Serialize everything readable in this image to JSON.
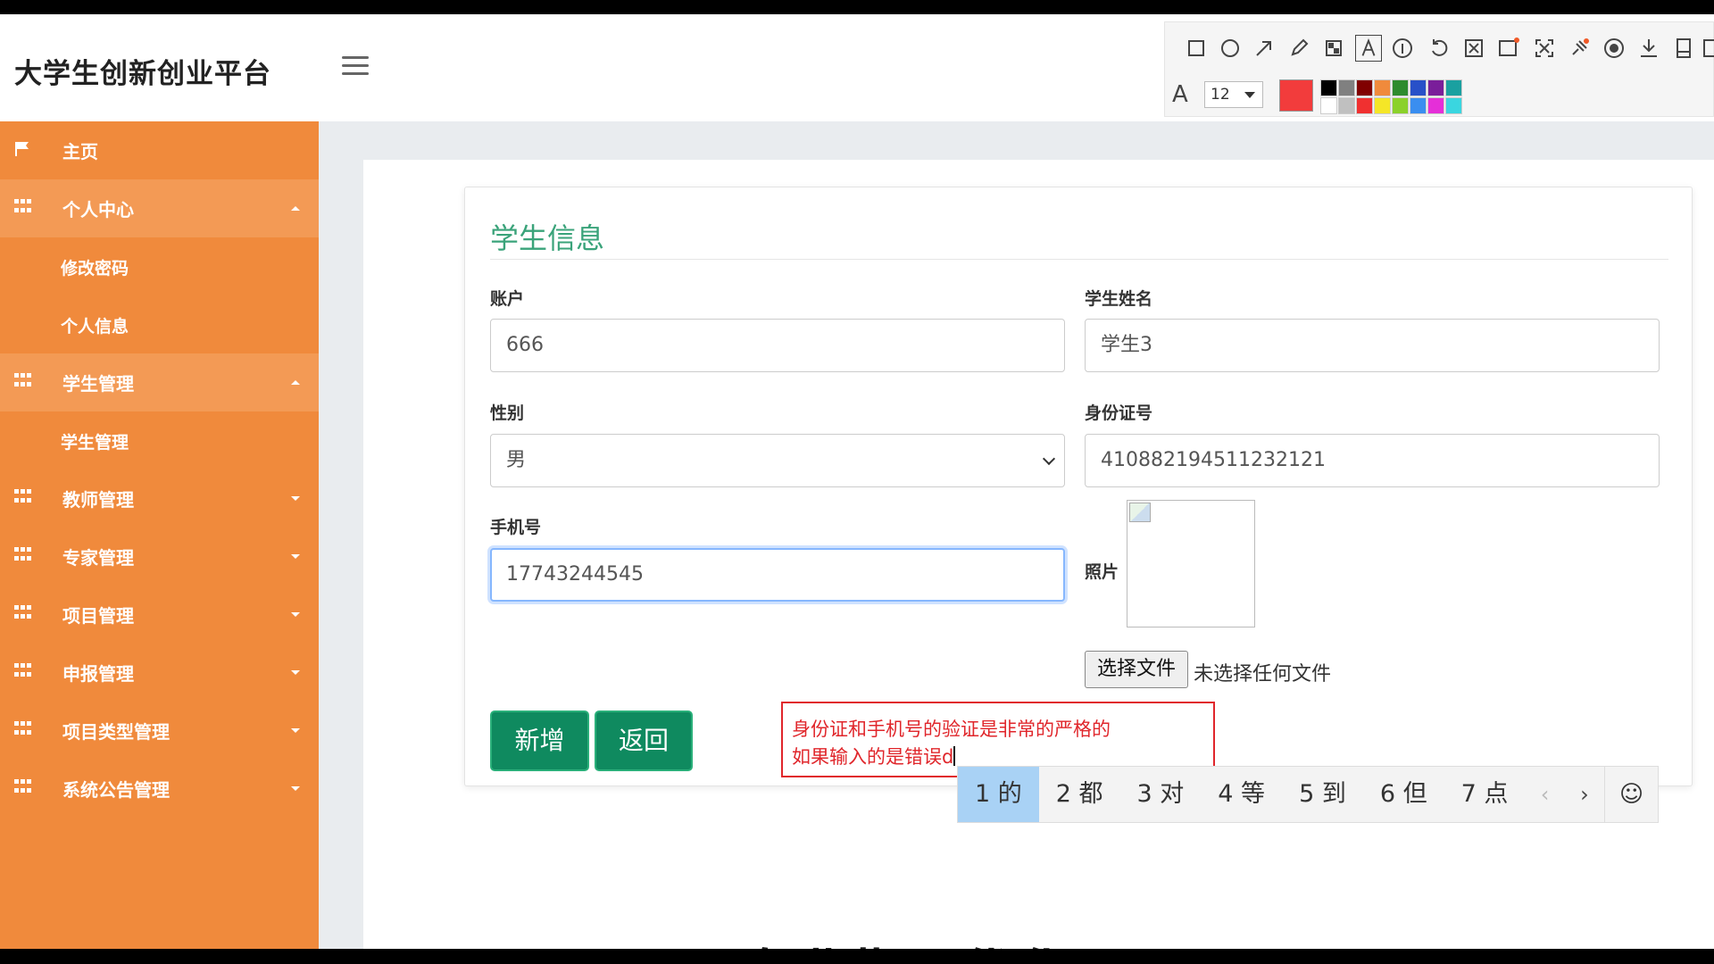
{
  "header": {
    "brand": "大学生创新创业平台"
  },
  "sidebar": {
    "items": [
      {
        "label": "主页",
        "icon": "flag-icon",
        "caret": ""
      },
      {
        "label": "个人中心",
        "icon": "grid-icon",
        "caret": "up",
        "children": [
          "修改密码",
          "个人信息"
        ]
      },
      {
        "label": "学生管理",
        "icon": "grid-icon",
        "caret": "up",
        "children": [
          "学生管理"
        ]
      },
      {
        "label": "教师管理",
        "icon": "grid-icon",
        "caret": "down"
      },
      {
        "label": "专家管理",
        "icon": "grid-icon",
        "caret": "down"
      },
      {
        "label": "项目管理",
        "icon": "grid-icon",
        "caret": "down"
      },
      {
        "label": "申报管理",
        "icon": "grid-icon",
        "caret": "down"
      },
      {
        "label": "项目类型管理",
        "icon": "grid-icon",
        "caret": "down"
      },
      {
        "label": "系统公告管理",
        "icon": "grid-icon",
        "caret": "down"
      }
    ]
  },
  "form": {
    "title": "学生信息",
    "account_label": "账户",
    "account_value": "666",
    "name_label": "学生姓名",
    "name_value": "学生3",
    "gender_label": "性别",
    "gender_value": "男",
    "idcard_label": "身份证号",
    "idcard_value": "410882194511232121",
    "phone_label": "手机号",
    "phone_value": "17743244545",
    "photo_label": "照片",
    "file_button": "选择文件",
    "file_status": "未选择任何文件",
    "submit_button": "新增",
    "back_button": "返回"
  },
  "annotation": {
    "line1": "身份证和手机号的验证是非常的严格的",
    "line2": "如果输入的是错误d",
    "color": "#e0262b"
  },
  "ime": {
    "candidates": [
      "1 的",
      "2 都",
      "3 对",
      "4 等",
      "5 到",
      "6 但",
      "7 点"
    ],
    "selected_index": 0,
    "prev": "‹",
    "next": "›",
    "emoji": "☺"
  },
  "screenshot_toolbar": {
    "tools": [
      "rectangle-icon",
      "ellipse-icon",
      "arrow-icon",
      "pen-icon",
      "mosaic-icon",
      "text-icon",
      "number-icon",
      "undo-icon",
      "cut-icon",
      "translate-icon",
      "fullscreen-icon",
      "pin-icon",
      "record-icon",
      "download-icon",
      "save-icon",
      "copy-icon"
    ],
    "active_tool": "text-icon",
    "font_size": "12",
    "current_color": "#f23c3c",
    "swatches_top": [
      "#000000",
      "#808080",
      "#800000",
      "#f08a3c",
      "#2e8b2e",
      "#2850c8",
      "#7a1e9a",
      "#1aa0a0"
    ],
    "swatches_bottom": [
      "#ffffff",
      "#c0c0c0",
      "#f03030",
      "#f5e627",
      "#8bd12b",
      "#3a8ef0",
      "#e52fd8",
      "#3ad6e0"
    ]
  },
  "subtitle_partial": "专业指导优化"
}
